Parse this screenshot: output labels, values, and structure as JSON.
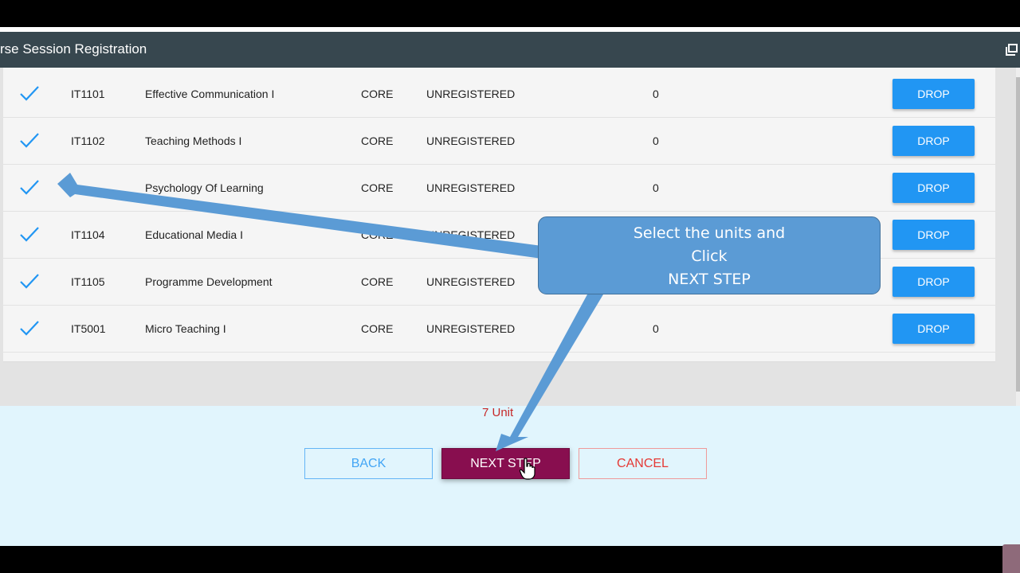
{
  "header": {
    "title": "rse Session Registration",
    "window_icon": "restore-window-icon"
  },
  "units": [
    {
      "code": "IT1101",
      "name": "Effective Communication I",
      "type": "CORE",
      "status": "UNREGISTERED",
      "count": "0",
      "action": "DROP"
    },
    {
      "code": "IT1102",
      "name": "Teaching Methods I",
      "type": "CORE",
      "status": "UNREGISTERED",
      "count": "0",
      "action": "DROP"
    },
    {
      "code": "",
      "name": "Psychology Of Learning",
      "type": "CORE",
      "status": "UNREGISTERED",
      "count": "0",
      "action": "DROP"
    },
    {
      "code": "IT1104",
      "name": "Educational Media I",
      "type": "CORE",
      "status": "UNREGISTERED",
      "count": "",
      "action": "DROP"
    },
    {
      "code": "IT1105",
      "name": "Programme Development",
      "type": "CORE",
      "status": "UNREGISTERED",
      "count": "",
      "action": "DROP"
    },
    {
      "code": "IT5001",
      "name": "Micro Teaching I",
      "type": "CORE",
      "status": "UNREGISTERED",
      "count": "0",
      "action": "DROP"
    }
  ],
  "footer": {
    "units_total": "7 Unit",
    "back_label": "BACK",
    "next_label": "NEXT STEP",
    "cancel_label": "CANCEL"
  },
  "callout": {
    "line1": "Select the units and",
    "line2": "Click",
    "line3": "NEXT STEP"
  },
  "colors": {
    "header_bg": "#37474f",
    "drop_button": "#2196f3",
    "check": "#2196f3",
    "next_button": "#880e4f",
    "cancel": "#e53935",
    "units_total": "#c62828",
    "footer_bg": "#e1f5fd",
    "callout_fill": "#5b9bd5"
  }
}
